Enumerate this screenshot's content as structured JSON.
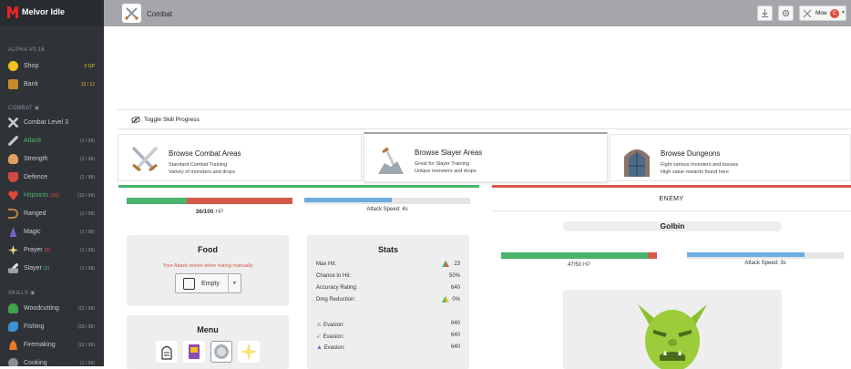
{
  "app": {
    "title": "Melvor Idle"
  },
  "sidebar": {
    "version": "ALPHA V0.16",
    "misc_items": [
      {
        "label": "Shop",
        "right": "0 GP"
      },
      {
        "label": "Bank",
        "right": "12 / 12"
      }
    ],
    "combat_section": "COMBAT",
    "combat_items": [
      {
        "label": "Combat Level 3",
        "right": ""
      },
      {
        "label": "Attack",
        "right": "(1 / 99)"
      },
      {
        "label": "Strength",
        "right": "(1 / 99)"
      },
      {
        "label": "Defence",
        "right": "(1 / 99)"
      },
      {
        "label": "Hitpoints",
        "sub": "(36)",
        "right": "(10 / 99)"
      },
      {
        "label": "Ranged",
        "right": "(1 / 99)"
      },
      {
        "label": "Magic",
        "right": "(1 / 99)"
      },
      {
        "label": "Prayer",
        "sub": "(0)",
        "right": "(1 / 99)"
      },
      {
        "label": "Slayer",
        "sub": "(5)",
        "right": "(1 / 99)"
      }
    ],
    "skills_section": "SKILLS",
    "skill_items": [
      {
        "label": "Woodcutting",
        "right": "(11 / 99)"
      },
      {
        "label": "Fishing",
        "right": "(33 / 99)"
      },
      {
        "label": "Firemaking",
        "right": "(12 / 99)"
      },
      {
        "label": "Cooking",
        "right": "(1 / 99)"
      }
    ]
  },
  "header": {
    "title": "Combat",
    "user": "Moe",
    "user_badge": "C"
  },
  "toggle": {
    "label": "Toggle Skill Progress"
  },
  "areas": [
    {
      "title": "Browse Combat Areas",
      "line1": "Standard Combat Training",
      "line2": "Variety of monsters and drops"
    },
    {
      "title": "Browse Slayer Areas",
      "line1": "Great for Slayer Training",
      "line2": "Unique monsters and drops"
    },
    {
      "title": "Browse Dungeons",
      "line1": "Fight various monsters and bosses",
      "line2": "High value rewards found here"
    }
  ],
  "player": {
    "hp_text": "36/100",
    "hp_unit": "HP",
    "hp_fraction": 0.36,
    "attack_speed": "Attack Speed: 4s",
    "attack_progress": 0.53,
    "food": {
      "title": "Food",
      "warning": "Your Attack resets when eating manually",
      "selected": "Empty"
    },
    "menu": {
      "title": "Menu"
    },
    "stats": {
      "title": "Stats",
      "rows": [
        {
          "label": "Max Hit:",
          "value": "23"
        },
        {
          "label": "Chance to Hit:",
          "value": "50%"
        },
        {
          "label": "Accuracy Rating:",
          "value": "640"
        },
        {
          "label": "Dmg Reduction:",
          "value": "0%"
        }
      ],
      "evasion": [
        {
          "label": "Evasion:",
          "value": "640"
        },
        {
          "label": "Evasion:",
          "value": "640"
        },
        {
          "label": "Evasion:",
          "value": "640"
        }
      ]
    }
  },
  "enemy": {
    "header": "ENEMY",
    "name": "Golbin",
    "hp_text": "47/50",
    "hp_unit": "HP",
    "hp_fraction": 0.94,
    "attack_speed": "Attack Speed: 3s",
    "attack_progress": 0.75
  },
  "colors": {
    "hp_green": "#4ab36c",
    "hp_red": "#d35a4a",
    "attack_blue": "#6aaee0",
    "sidebar": "#2f3338",
    "active": "#4ab36c"
  }
}
